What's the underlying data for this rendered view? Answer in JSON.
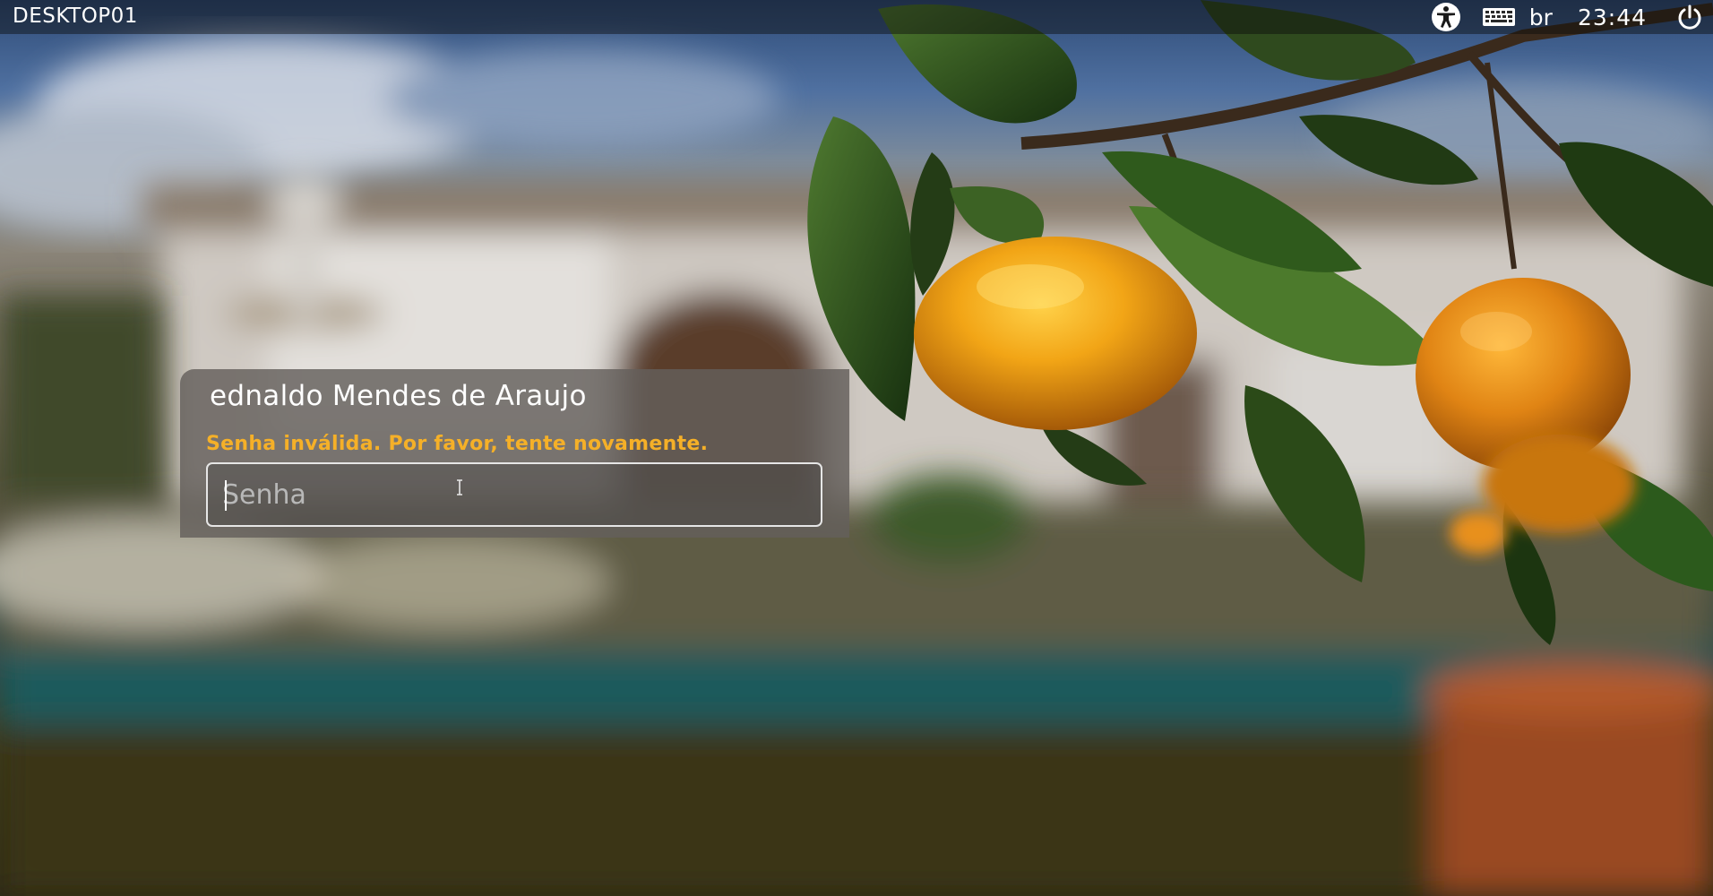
{
  "topbar": {
    "hostname": "DESKTOP01",
    "keyboard_layout": "br",
    "clock": "23:44",
    "icons": [
      "accessibility-icon",
      "keyboard-icon",
      "power-icon"
    ]
  },
  "login": {
    "user_name": "ednaldo Mendes de Araujo",
    "error_message": "Senha inválida. Por favor, tente novamente.",
    "password_placeholder": "Senha",
    "password_value": "",
    "error_color": "#f5b028"
  },
  "wallpaper": {
    "description_icon": "orange-tree-wallpaper"
  }
}
